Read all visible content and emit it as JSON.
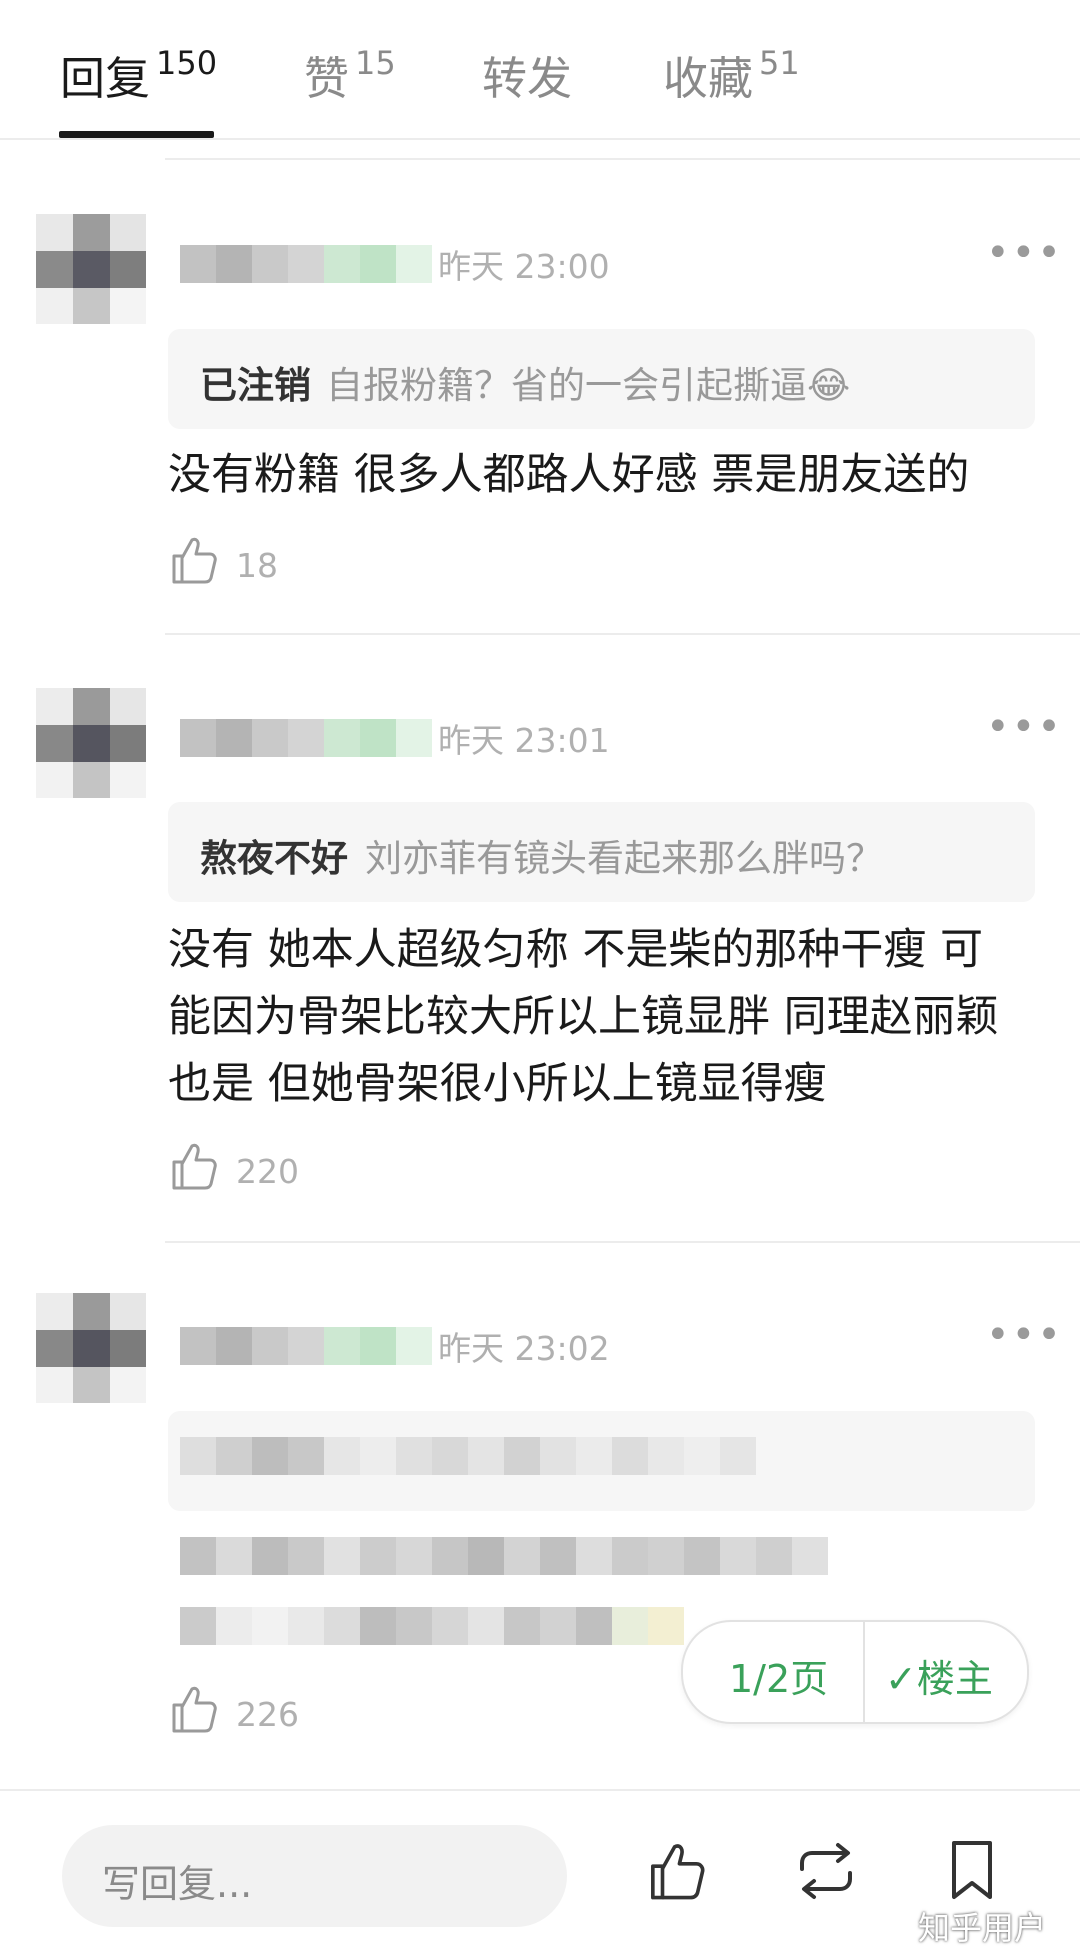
{
  "tabs": [
    {
      "label": "回复",
      "count": "150",
      "active": true
    },
    {
      "label": "赞",
      "count": "15",
      "active": false
    },
    {
      "label": "转发",
      "count": "",
      "active": false
    },
    {
      "label": "收藏",
      "count": "51",
      "active": false
    }
  ],
  "comments": [
    {
      "time": "昨天 23:00",
      "quote_author": "已注销",
      "quote_text": "自报粉籍？省的一会引起撕逼😂",
      "body": "没有粉籍 很多人都路人好感 票是朋友送的",
      "likes": "18"
    },
    {
      "time": "昨天 23:01",
      "quote_author": "熬夜不好",
      "quote_text": "刘亦菲有镜头看起来那么胖吗？",
      "body_lines": [
        "没有 她本人超级匀称 不是柴的那种干瘦 可",
        "能因为骨架比较大所以上镜显胖 同理赵丽颖",
        "也是 但她骨架很小所以上镜显得瘦"
      ],
      "likes": "220"
    },
    {
      "time": "昨天 23:02",
      "likes": "226"
    }
  ],
  "pager": {
    "page": "1/2页",
    "op_label": "楼主",
    "op_check": "✓"
  },
  "bottom_bar": {
    "reply_placeholder": "写回复...",
    "icons": [
      "like-icon",
      "repost-icon",
      "bookmark-icon"
    ]
  },
  "watermark": "知乎用户",
  "colors": {
    "accent_green": "#3aa15a",
    "text_muted": "#b0b0b0",
    "quote_bg": "#f6f6f6"
  }
}
